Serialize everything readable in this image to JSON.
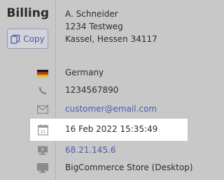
{
  "section": {
    "title": "Billing",
    "copy_label": "Copy"
  },
  "address": {
    "name": "A. Schneider",
    "street": "1234 Testweg",
    "city_line": "Kassel, Hessen 34117"
  },
  "details": {
    "country": "Germany",
    "phone": "1234567890",
    "email": "customer@email.com",
    "date": "16 Feb 2022 15:35:49",
    "ip": "68.21.145.6",
    "store": "BigCommerce Store (Desktop)"
  },
  "icons": {
    "country": "germany-flag-icon",
    "phone": "phone-icon",
    "email": "envelope-icon",
    "date": "calendar-icon",
    "ip": "ip-address-icon",
    "store": "desktop-monitor-icon"
  },
  "colors": {
    "link": "#4a5bb2",
    "button_border": "#8f9ac2",
    "highlight_bg": "#ffffff"
  }
}
